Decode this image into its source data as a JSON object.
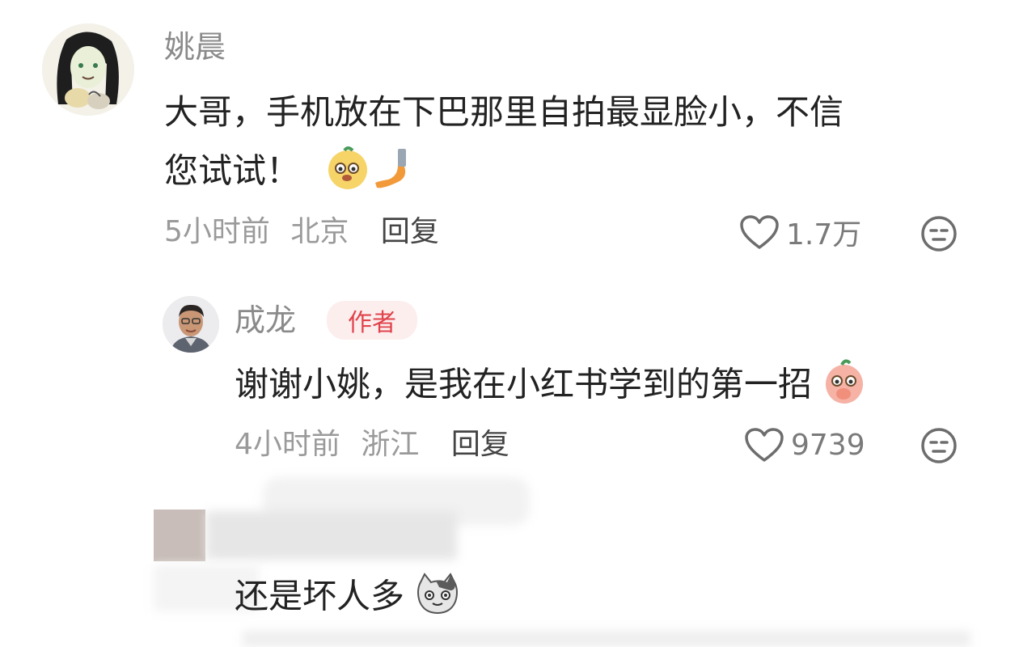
{
  "comment1": {
    "author": "姚晨",
    "text_line1": "大哥，手机放在下巴那里自拍最显脸小，不信",
    "text_line2": "您试试！",
    "time": "5小时前",
    "location": "北京",
    "reply_label": "回复",
    "likes": "1.7万"
  },
  "reply1": {
    "author": "成龙",
    "badge": "作者",
    "text": "谢谢小姚，是我在小红书学到的第一招",
    "time": "4小时前",
    "location": "浙江",
    "reply_label": "回复",
    "likes": "9739"
  },
  "reply2": {
    "text": "还是坏人多"
  },
  "colors": {
    "accent_red": "#e0434b",
    "badge_bg": "#fdeeee",
    "meta_gray": "#9a9a9a",
    "text": "#222222"
  }
}
